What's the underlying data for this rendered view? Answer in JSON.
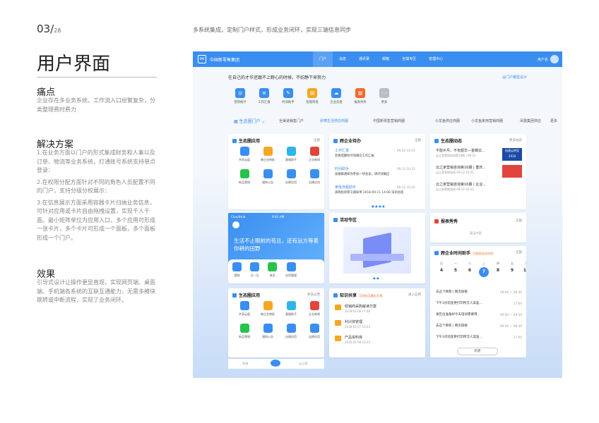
{
  "page": {
    "num": "03/",
    "total": "28",
    "subtitle": "多系统集成，定制门户样式，形成业务闭环，实现三端信息同步",
    "title": "用户界面"
  },
  "sections": [
    {
      "heading": "痛点",
      "paras": [
        "企业存在多业务系统，工作流入口纷繁复杂，分类整理费时费力"
      ]
    },
    {
      "heading": "解决方案",
      "paras": [
        "1.在业务方面以门户的形式集成财务和人事以及订单、物流等业务系统，打通账号系统支持单点登录：",
        "2.在权限分配方面针对不同的角色人员配置不同的门户，支持分级分权展示：",
        "3.在信息展示方面采用容器卡片归纳业务信息，可针对应用或卡片自由拖拽设置，实现千人千面。最小矩阵单位为应用入口，多个应用可形成一张卡片，多个卡片可形成一个面板，多个面板形成一个门户。"
      ]
    },
    {
      "heading": "效果",
      "paras": [
        "引导式设计让操作更显直观，实现网页端、桌面端、手机端各系统的互联互通能力，无需多模块跳转或中断流程，实现了业务闭环。"
      ]
    }
  ],
  "mock": {
    "brand": "中国新零售集团",
    "nav": [
      "门户",
      "消息",
      "通讯录",
      "邮箱",
      "全端专区",
      "管理中心"
    ],
    "user": "用户名",
    "greeting": "在自己的才华还跟不上野心的时候，不妨静下来努力",
    "greet_link": "@门户模型设计",
    "apps": [
      {
        "label": "营销统计",
        "color": "#3a8ef0",
        "glyph": "◎"
      },
      {
        "label": "工作汇报",
        "color": "#3a8ef0",
        "glyph": "≡"
      },
      {
        "label": "时间助手",
        "color": "#3a8ef0",
        "glyph": "✎"
      },
      {
        "label": "智能审批",
        "color": "#f5a623",
        "glyph": "▤"
      },
      {
        "label": "企业云盘",
        "color": "#3a8ef0",
        "glyph": "☁"
      },
      {
        "label": "报表秀秀",
        "color": "#f2692a",
        "glyph": "▥"
      },
      {
        "label": "更多",
        "color": "#b8bec8",
        "glyph": "⋯"
      }
    ],
    "tabs": [
      "生态圈门户",
      "全渠道销售门户",
      "秒莺生活供应商圈",
      "中国新零售营销商圈",
      "小龙鱼供应商圈",
      "小龙鱼家用营销商圈",
      "凤凰集团供应",
      "更多"
    ],
    "eco": {
      "title": "生态圈应用",
      "more": "全部",
      "items": [
        {
          "label": "共享云盘",
          "color": "#3a8ef0"
        },
        {
          "label": "跨企业审批",
          "color": "#f5a623"
        },
        {
          "label": "客服助手",
          "color": "#2cb6e8"
        },
        {
          "label": "企业新闻",
          "color": "#e0463c"
        },
        {
          "label": "新品营销",
          "color": "#27c24c"
        },
        {
          "label": "通知公告",
          "color": "#3a8ef0"
        },
        {
          "label": "自建应用",
          "color": "#3a8ef0"
        },
        {
          "label": "自建应用",
          "color": "#3a8ef0"
        }
      ]
    },
    "todo": {
      "title": "跨企业待办",
      "more": "全部",
      "items": [
        {
          "tag": "工作汇报",
          "text": "老板提醒你尽快确交工作汇报",
          "time": "09-12 10:23"
        },
        {
          "tag": "时间助手",
          "text": "发展群通知你参加一场会议，请尽快确应",
          "time": "09-12 10:23"
        },
        {
          "tag": "审批流程助手",
          "text": "高晓松的移交通知单 2018-09-11 14:08 深圳总部",
          "time": "09-12 10:23"
        }
      ]
    },
    "news": {
      "title": "生态圈动态",
      "more": "更多动态",
      "items": [
        {
          "text": "不能乡月，不负韶华—金蝶云...",
          "sub": "云之家营销咨询第16期 | 09-12"
        },
        {
          "text": "云之家营销咨询第16期 | 重庆...",
          "sub": "云之家营销咨询 09-12 10:23"
        },
        {
          "text": "云之家营销咨询第16期 | 企业...",
          "sub": "云之家营销咨询 09-12 10:23"
        }
      ],
      "badge1": "加速云转型",
      "badge2": "2018"
    },
    "phone": {
      "status_left": "CloudHub",
      "status_time": "9:41 AM",
      "quote": "生活不止眼前的苟且，还有远方等着你耕的田野",
      "apps": [
        "营销",
        "日一日",
        "电话",
        "应用管理"
      ]
    },
    "activity": {
      "title": "活动专区"
    },
    "report": {
      "title": "报表秀秀",
      "more": "全部",
      "empty": "暂无内容"
    },
    "calendar": {
      "title": "跨企业时间助手",
      "link": "可安排会议时间",
      "more": "全部",
      "days": [
        {
          "w": "日",
          "d": "4"
        },
        {
          "w": "一",
          "d": "5"
        },
        {
          "w": "二",
          "d": "6"
        },
        {
          "w": "三",
          "d": "7"
        },
        {
          "w": "四",
          "d": "8"
        },
        {
          "w": "五",
          "d": "9"
        },
        {
          "w": "六",
          "d": "10"
        }
      ],
      "events": [
        {
          "text": "去这个网卷 | 网页链接",
          "time": "09:00 — 09:30"
        },
        {
          "text": "下午3点前变更打印所交人案准...",
          "time": "17:00"
        },
        {
          "text": "请告位准备好今天培训需要用...",
          "time": "09:00 — 09:30"
        },
        {
          "text": "去这个网卷 | 网页链接",
          "time": "09:00 — 09:30"
        },
        {
          "text": "下午3点前变更打印所交人案准...",
          "time": "17:00"
        }
      ],
      "add": "新建"
    },
    "eco2": {
      "title": "生态圈应用",
      "more": "更多应用"
    },
    "knowledge": {
      "title": "知识共享",
      "link": "可浏览至最近文章",
      "more": "进入应用",
      "items": [
        {
          "text": "经销商采购解读方案",
          "sub": "2018-02-06 17:48"
        },
        {
          "text": "利兴体管理",
          "sub": "2018-02-07 10:23"
        },
        {
          "text": "产品资料库",
          "sub": "2018-01-08 10:23"
        }
      ]
    },
    "phone_tabs": [
      "消息",
      "",
      "云之家"
    ]
  }
}
